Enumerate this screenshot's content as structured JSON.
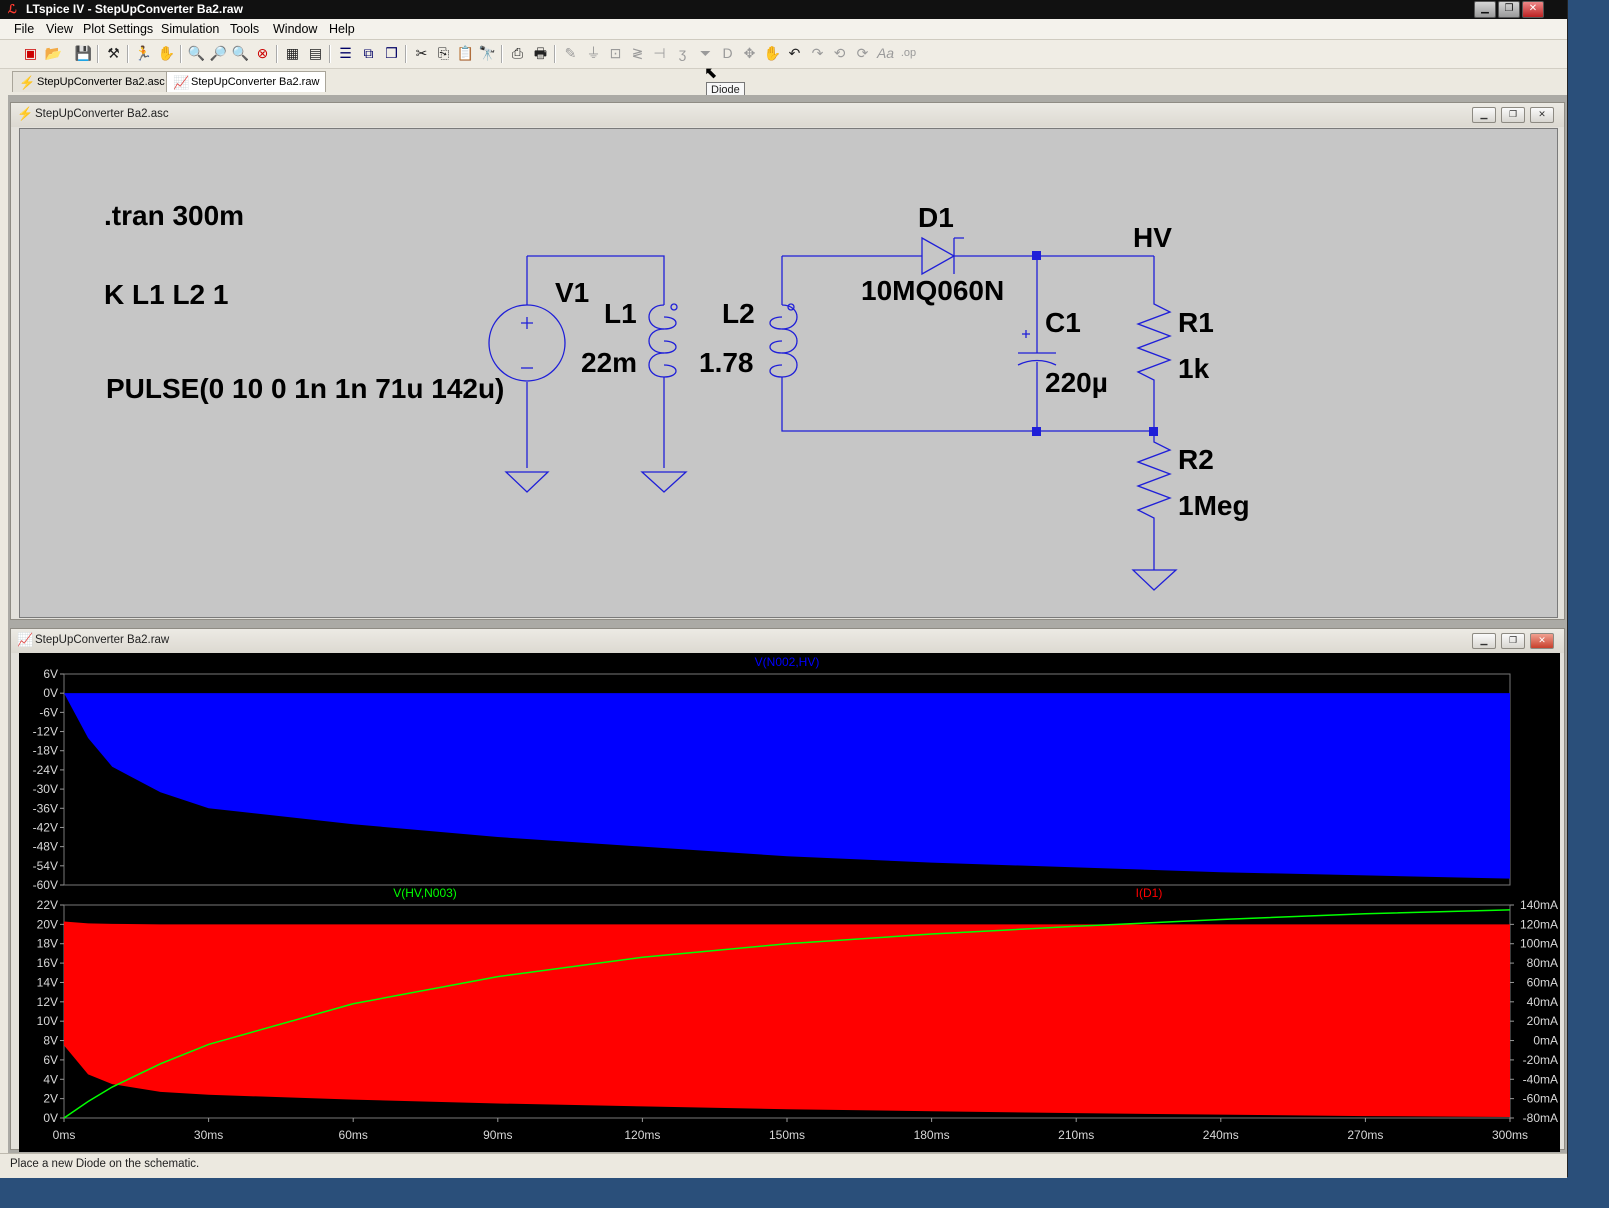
{
  "window": {
    "title": "LTspice IV - StepUpConverter Ba2.raw",
    "app_icon": "ltspice-icon"
  },
  "menu": [
    "File",
    "View",
    "Plot Settings",
    "Simulation",
    "Tools",
    "Window",
    "Help"
  ],
  "tooltip": "Diode",
  "tabs": [
    "StepUpConverter Ba2.asc",
    "StepUpConverter Ba2.raw"
  ],
  "schematic_window": {
    "title": "StepUpConverter Ba2.asc",
    "directives": [
      ".tran 300m",
      "K L1 L2 1",
      "PULSE(0 10 0 1n 1n 71u 142u)"
    ],
    "labels": {
      "v1": "V1",
      "l1": "L1",
      "l1_val": "22m",
      "l2": "L2",
      "l2_val": "1.78",
      "d1": "D1",
      "d1_val": "10MQ060N",
      "hv": "HV",
      "c1": "C1",
      "c1_val": "220µ",
      "r1": "R1",
      "r1_val": "1k",
      "r2": "R2",
      "r2_val": "1Meg"
    }
  },
  "waveform_window": {
    "title": "StepUpConverter Ba2.raw"
  },
  "chart_data": [
    {
      "type": "area",
      "title": "V(N002,HV)",
      "ylim": [
        -60,
        6
      ],
      "y_ticks": [
        "6V",
        "0V",
        "-6V",
        "-12V",
        "-18V",
        "-24V",
        "-30V",
        "-36V",
        "-42V",
        "-48V",
        "-54V",
        "-60V"
      ],
      "x": [
        0,
        5,
        10,
        20,
        30,
        60,
        90,
        120,
        150,
        180,
        210,
        240,
        270,
        300
      ],
      "series": [
        {
          "name": "V(N002,HV)",
          "color": "#0000ff",
          "upper": [
            0,
            0,
            0,
            0,
            0,
            0,
            0,
            0,
            0,
            0,
            0,
            0,
            0,
            0
          ],
          "lower": [
            0,
            -14,
            -23,
            -31,
            -36,
            -41,
            -45,
            -48,
            -51,
            -53,
            -54.5,
            -56,
            -57,
            -58
          ]
        }
      ]
    },
    {
      "type": "area",
      "series_labels": [
        "V(HV,N003)",
        "I(D1)"
      ],
      "ylim_left": [
        0,
        22
      ],
      "y_ticks_left": [
        "22V",
        "20V",
        "18V",
        "16V",
        "14V",
        "12V",
        "10V",
        "8V",
        "6V",
        "4V",
        "2V",
        "0V"
      ],
      "ylim_right": [
        -80,
        140
      ],
      "y_ticks_right": [
        "140mA",
        "120mA",
        "100mA",
        "80mA",
        "60mA",
        "40mA",
        "20mA",
        "0mA",
        "-20mA",
        "-40mA",
        "-60mA",
        "-80mA"
      ],
      "x_ticks": [
        "0ms",
        "30ms",
        "60ms",
        "90ms",
        "120ms",
        "150ms",
        "180ms",
        "210ms",
        "240ms",
        "270ms",
        "300ms"
      ],
      "x": [
        0,
        5,
        10,
        20,
        30,
        60,
        90,
        120,
        150,
        180,
        210,
        240,
        270,
        300
      ],
      "series": [
        {
          "name": "I(D1)",
          "color": "#ff0000",
          "upper": [
            123,
            121,
            120.5,
            120,
            120,
            120,
            120,
            120,
            120,
            120,
            120,
            120,
            120,
            120
          ],
          "lower": [
            -5,
            -35,
            -45,
            -53,
            -56,
            -61,
            -65,
            -68,
            -71,
            -73,
            -75,
            -76.5,
            -78,
            -79
          ]
        },
        {
          "name": "V(HV,N003)",
          "color": "#00ff00",
          "values": [
            0,
            1.7,
            3.2,
            5.6,
            7.6,
            11.8,
            14.6,
            16.6,
            18.0,
            19.0,
            19.8,
            20.5,
            21.1,
            21.5
          ]
        }
      ]
    }
  ],
  "status": "Place a new Diode on the schematic."
}
